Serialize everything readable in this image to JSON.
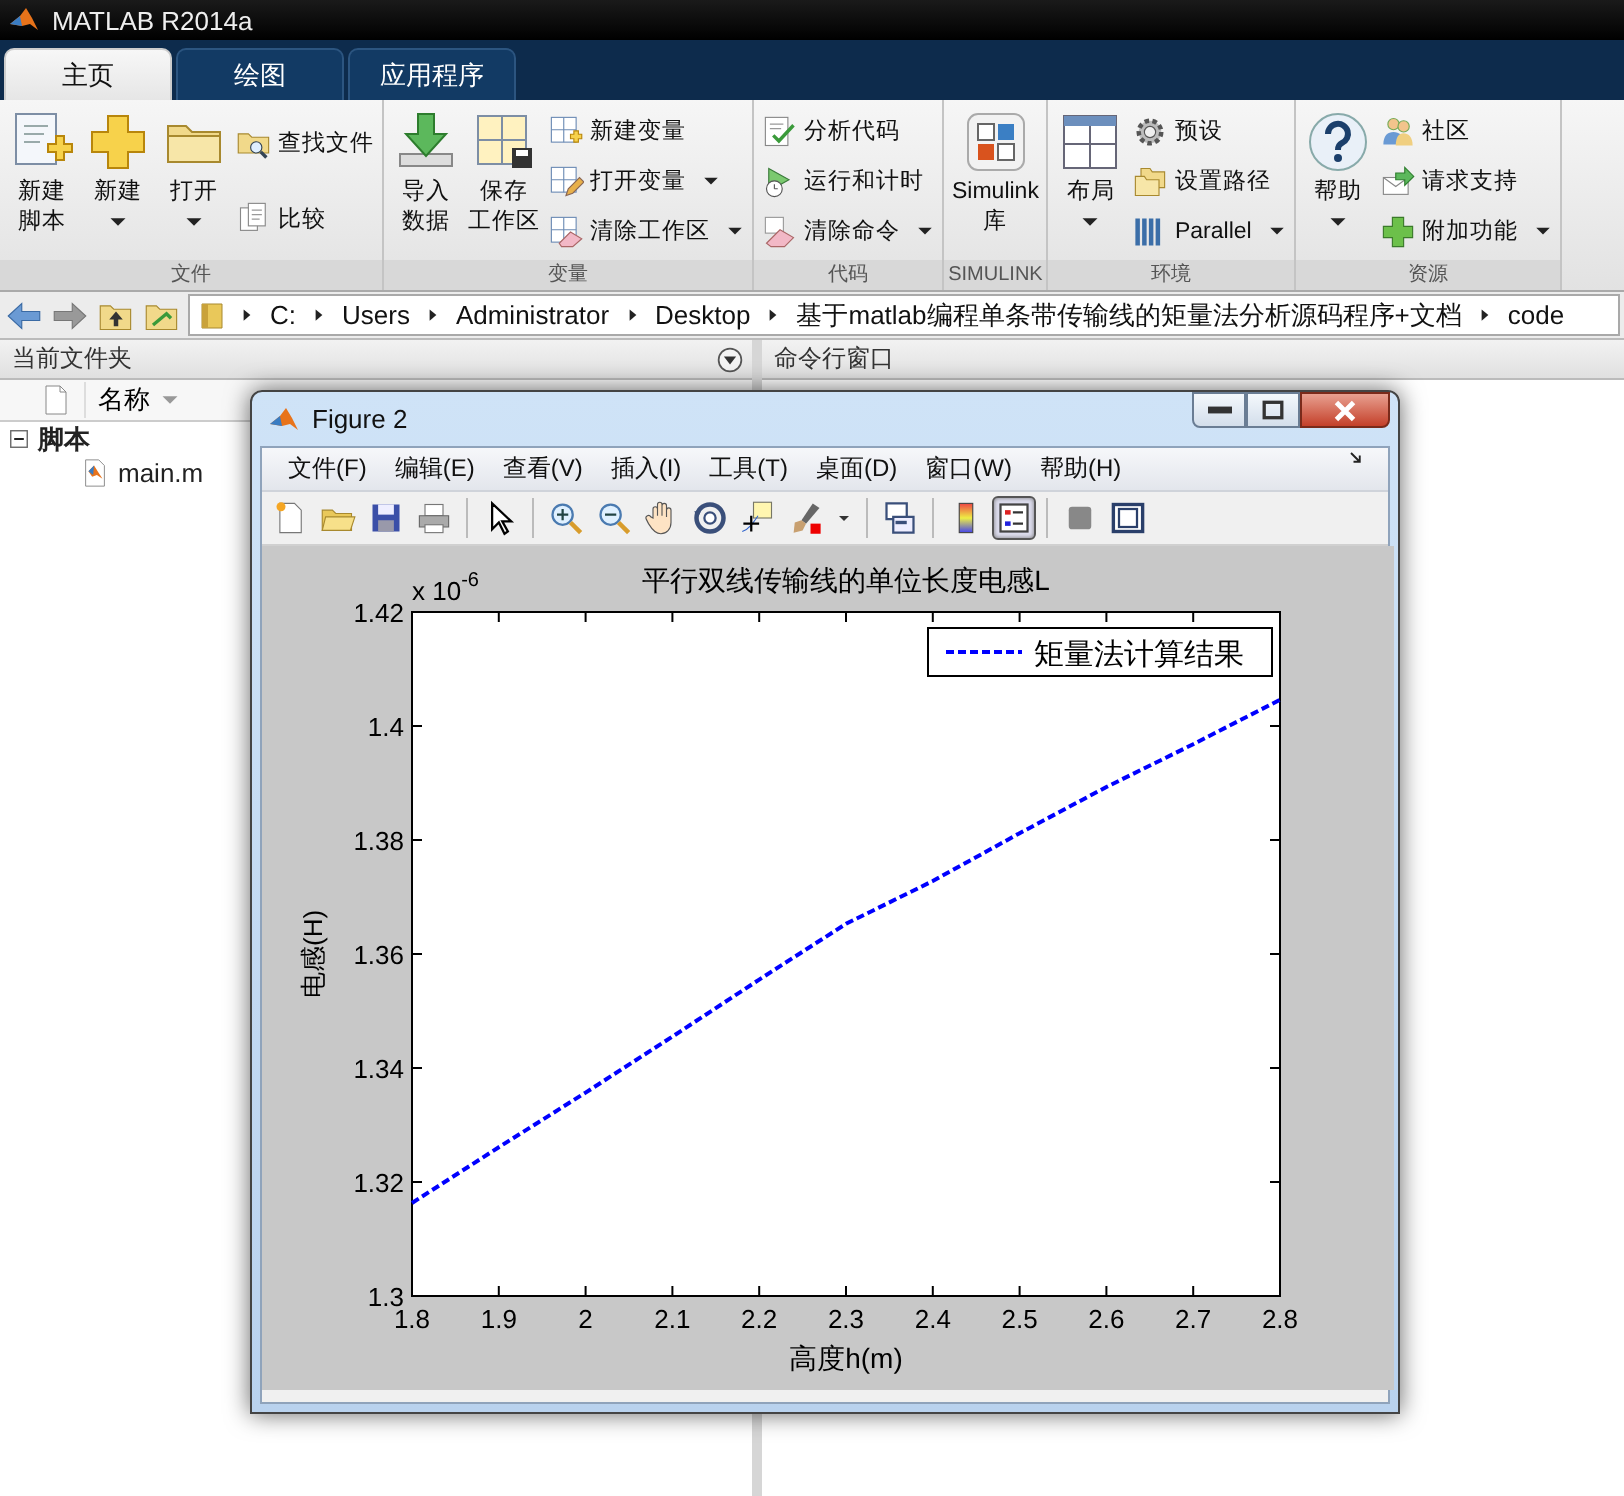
{
  "app": {
    "title": "MATLAB R2014a"
  },
  "tabs": [
    {
      "label": "主页",
      "selected": true
    },
    {
      "label": "绘图",
      "selected": false
    },
    {
      "label": "应用程序",
      "selected": false
    }
  ],
  "ribbon": [
    {
      "title": "文件",
      "items": [
        {
          "kind": "large",
          "lines": [
            "新建",
            "脚本"
          ],
          "dropdown": false
        },
        {
          "kind": "large",
          "lines": [
            "新建"
          ],
          "dropdown": true
        },
        {
          "kind": "large",
          "lines": [
            "打开"
          ],
          "dropdown": true
        },
        {
          "kind": "column",
          "items": [
            {
              "label": "查找文件",
              "dropdown": false
            },
            {
              "label": "比较",
              "dropdown": false
            }
          ]
        }
      ]
    },
    {
      "title": "变量",
      "items": [
        {
          "kind": "large",
          "lines": [
            "导入",
            "数据"
          ],
          "dropdown": false
        },
        {
          "kind": "large",
          "lines": [
            "保存",
            "工作区"
          ],
          "dropdown": false
        },
        {
          "kind": "column",
          "items": [
            {
              "label": "新建变量",
              "dropdown": false
            },
            {
              "label": "打开变量",
              "dropdown": true
            },
            {
              "label": "清除工作区",
              "dropdown": true
            }
          ]
        }
      ]
    },
    {
      "title": "代码",
      "items": [
        {
          "kind": "column",
          "items": [
            {
              "label": "分析代码",
              "dropdown": false
            },
            {
              "label": "运行和计时",
              "dropdown": false
            },
            {
              "label": "清除命令",
              "dropdown": true
            }
          ]
        }
      ]
    },
    {
      "title": "SIMULINK",
      "items": [
        {
          "kind": "large",
          "lines": [
            "Simulink",
            "库"
          ],
          "dropdown": false
        }
      ]
    },
    {
      "title": "环境",
      "items": [
        {
          "kind": "large",
          "lines": [
            "布局"
          ],
          "dropdown": true
        },
        {
          "kind": "column",
          "items": [
            {
              "label": "预设",
              "dropdown": false
            },
            {
              "label": "设置路径",
              "dropdown": false
            },
            {
              "label": "Parallel",
              "dropdown": true
            }
          ]
        }
      ]
    },
    {
      "title": "资源",
      "items": [
        {
          "kind": "large",
          "lines": [
            "帮助"
          ],
          "dropdown": true
        },
        {
          "kind": "column",
          "items": [
            {
              "label": "社区",
              "dropdown": false
            },
            {
              "label": "请求支持",
              "dropdown": false
            },
            {
              "label": "附加功能",
              "dropdown": true
            }
          ]
        }
      ]
    }
  ],
  "address": {
    "path": [
      "C:",
      "Users",
      "Administrator",
      "Desktop",
      "基于matlab编程单条带传输线的矩量法分析源码程序+文档",
      "code"
    ]
  },
  "current_folder": {
    "title": "当前文件夹",
    "column": "名称",
    "tree": [
      {
        "label": "脚本",
        "expanded": true,
        "children": [
          {
            "label": "main.m"
          }
        ]
      }
    ]
  },
  "command_window": {
    "title": "命令行窗口"
  },
  "figure": {
    "title": "Figure 2",
    "menu": [
      "文件(F)",
      "编辑(E)",
      "查看(V)",
      "插入(I)",
      "工具(T)",
      "桌面(D)",
      "窗口(W)",
      "帮助(H)"
    ],
    "toolbar": [
      {
        "pressed": false
      },
      {
        "pressed": false
      },
      {
        "pressed": false
      },
      {
        "pressed": false
      },
      {
        "pressed": false
      },
      {
        "pressed": false
      },
      {
        "pressed": false
      },
      {
        "pressed": false
      },
      {
        "pressed": false
      },
      {
        "pressed": false
      },
      {
        "pressed": false
      },
      {
        "pressed": false
      },
      {
        "pressed": false
      },
      {
        "pressed": false
      },
      {
        "pressed": true
      },
      {
        "pressed": false
      },
      {
        "pressed": false
      }
    ],
    "plot": {
      "y_multiplier": {
        "base": "x 10",
        "exponent": "-6"
      },
      "chart_data": {
        "type": "line",
        "title": "平行双线传输线的单位长度电感L",
        "xlabel": "高度h(m)",
        "ylabel": "电感(H)",
        "x": [
          1.8,
          1.9,
          2.0,
          2.1,
          2.2,
          2.3,
          2.4,
          2.5,
          2.6,
          2.7,
          2.8
        ],
        "series": [
          {
            "name": "矩量法计算结果",
            "color": "#0000ff",
            "line_style": "dashed",
            "values": [
              1.3163,
              1.3261,
              1.3357,
              1.3455,
              1.3555,
              1.3653,
              1.3728,
              1.3812,
              1.3893,
              1.3968,
              1.4046
            ]
          }
        ],
        "xlim": [
          1.8,
          2.8
        ],
        "ylim": [
          1.3,
          1.42
        ],
        "xticks": [
          1.8,
          1.9,
          2,
          2.1,
          2.2,
          2.3,
          2.4,
          2.5,
          2.6,
          2.7,
          2.8
        ],
        "yticks": [
          1.3,
          1.32,
          1.34,
          1.36,
          1.38,
          1.4,
          1.42
        ]
      }
    }
  }
}
